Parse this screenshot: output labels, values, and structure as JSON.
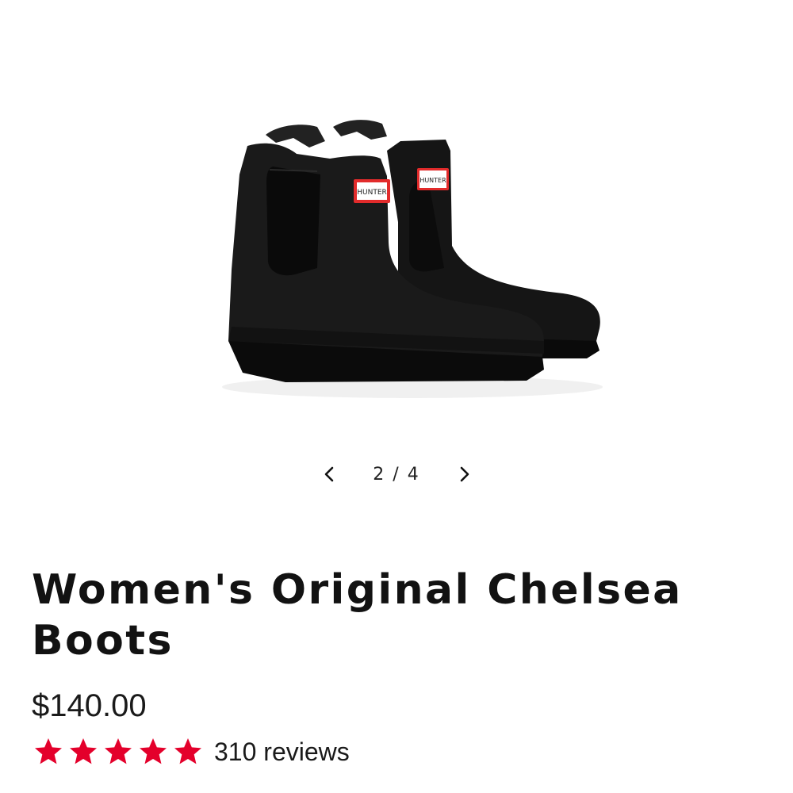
{
  "product": {
    "image_alt": "black chelsea boots",
    "boot_logo_text": "HUNTER",
    "title": "Women's Original Chelsea Boots",
    "price": "$140.00",
    "rating": {
      "stars": 5,
      "max_stars": 5,
      "star_color": "#e4002b",
      "reviews_text": "310 reviews"
    }
  },
  "gallery": {
    "pager_text": "2 / 4",
    "prev_icon": "chevron-left-icon",
    "next_icon": "chevron-right-icon"
  }
}
